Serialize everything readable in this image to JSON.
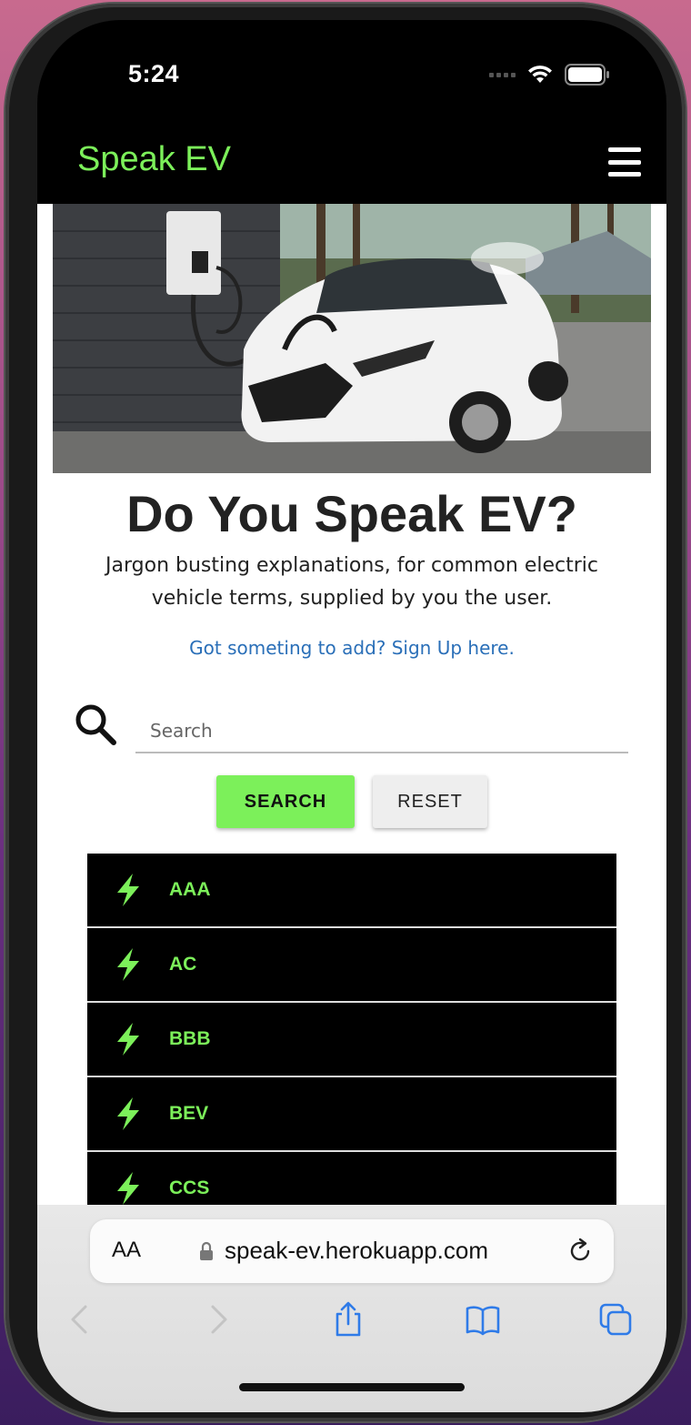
{
  "status_bar": {
    "time": "5:24"
  },
  "header": {
    "brand": "Speak EV",
    "menu_icon": "hamburger-menu-icon"
  },
  "hero": {
    "image": "white electric car charging at wall charger"
  },
  "main": {
    "headline": "Do You Speak EV?",
    "subtext": "Jargon busting explanations, for common electric vehicle terms, supplied by you the user.",
    "signup_link": "Got someting to add? Sign Up here."
  },
  "search": {
    "icon": "search-icon",
    "placeholder": "Search",
    "search_button": "SEARCH",
    "reset_button": "RESET"
  },
  "terms": [
    {
      "label": "AAA",
      "icon": "lightning-bolt-icon"
    },
    {
      "label": "AC",
      "icon": "lightning-bolt-icon"
    },
    {
      "label": "BBB",
      "icon": "lightning-bolt-icon"
    },
    {
      "label": "BEV",
      "icon": "lightning-bolt-icon"
    },
    {
      "label": "CCS",
      "icon": "lightning-bolt-icon"
    }
  ],
  "browser": {
    "text_size": "AA",
    "url": "speak-ev.herokuapp.com"
  },
  "colors": {
    "accent": "#7cf05a",
    "header_bg": "#000000",
    "link": "#2a6fb8"
  }
}
